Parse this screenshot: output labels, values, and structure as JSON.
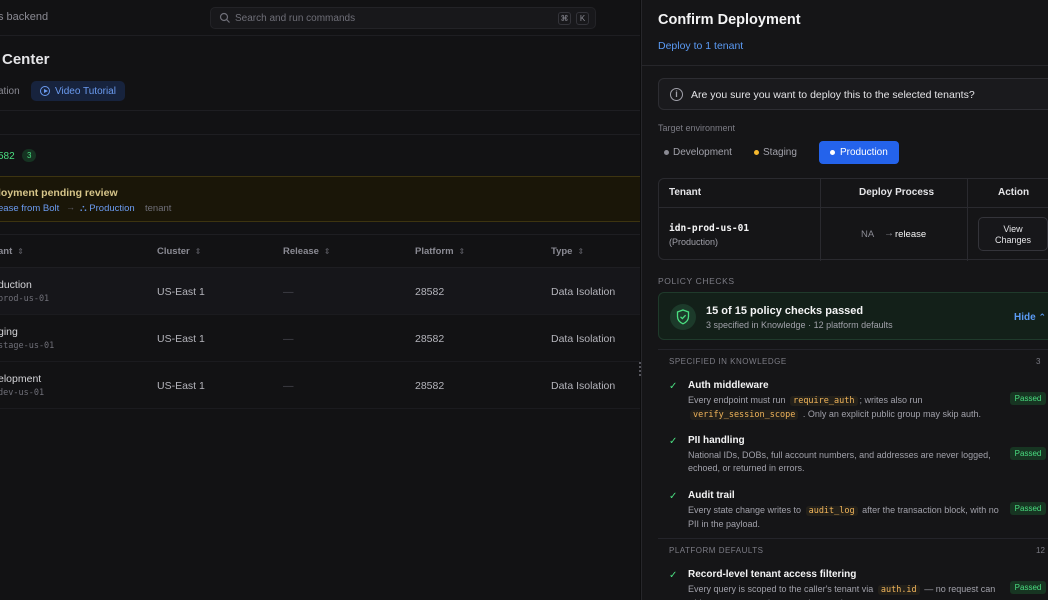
{
  "background": {
    "breadcrumb": "s backend",
    "search_placeholder": "Search and run commands",
    "shortcut_keys": [
      "⌘",
      "K"
    ],
    "page_title": "Center",
    "subtab": "ation",
    "video_tutorial": "Video Tutorial",
    "build_label": "582",
    "build_count": "3",
    "pending": {
      "title": "loyment pending review",
      "release": "ease from Bolt",
      "target": "Production",
      "suffix": "tenant"
    },
    "table": {
      "headers": [
        "ant",
        "Cluster",
        "Release",
        "Platform",
        "Type"
      ],
      "rows": [
        {
          "name": "duction",
          "id": "prod-us-01",
          "cluster": "US-East 1",
          "release": "—",
          "platform": "28582",
          "type": "Data Isolation"
        },
        {
          "name": "ging",
          "id": "stage-us-01",
          "cluster": "US-East 1",
          "release": "—",
          "platform": "28582",
          "type": "Data Isolation"
        },
        {
          "name": "elopment",
          "id": "dev-us-01",
          "cluster": "US-East 1",
          "release": "—",
          "platform": "28582",
          "type": "Data Isolation"
        }
      ]
    }
  },
  "panel": {
    "title": "Confirm Deployment",
    "subtitle": "Deploy to 1 tenant",
    "confirm_text": "Are you sure you want to deploy this to the selected tenants?",
    "env_label": "Target environment",
    "env_tabs": [
      {
        "label": "Development",
        "dot": "#8a8a93"
      },
      {
        "label": "Staging",
        "dot": "#f5b82e"
      },
      {
        "label": "Production",
        "dot": "#ffffff"
      }
    ],
    "table": {
      "headers": {
        "tenant": "Tenant",
        "process": "Deploy Process",
        "action": "Action"
      },
      "row": {
        "tenant": "idn-prod-us-01",
        "env": "(Production)",
        "from": "NA",
        "to": "release",
        "action_line1": "View",
        "action_line2": "Changes"
      }
    },
    "policy_label": "POLICY CHECKS",
    "policy_summary": {
      "title": "15 of 15 policy checks passed",
      "subtitle": "3 specified in Knowledge · 12 platform defaults",
      "toggle": "Hide"
    },
    "sections": [
      {
        "label": "SPECIFIED IN KNOWLEDGE",
        "count": "3"
      },
      {
        "label": "PLATFORM DEFAULTS",
        "count": "12"
      }
    ],
    "checks": [
      {
        "title": "Auth middleware",
        "pre": "Every endpoint must run",
        "code1": "require_auth",
        "mid": "; writes also run",
        "code2": "verify_session_scope",
        "post": ". Only an explicit public group may skip auth.",
        "status": "Passed"
      },
      {
        "title": "PII handling",
        "desc": "National IDs, DOBs, full account numbers, and addresses are never logged, echoed, or returned in errors.",
        "status": "Passed"
      },
      {
        "title": "Audit trail",
        "pre": "Every state change writes to",
        "code1": "audit_log",
        "post": "after the transaction block, with no PII in the payload.",
        "status": "Passed"
      },
      {
        "title": "Record-level tenant access filtering",
        "pre": "Every query is scoped to the caller's tenant via",
        "code1": "auth.id",
        "post": "— no request can widen scope to another tenant's records.",
        "status": "Passed"
      }
    ],
    "colors": {
      "accent": "#2463eb",
      "success": "#4ade80",
      "link": "#5b9bf5"
    }
  }
}
